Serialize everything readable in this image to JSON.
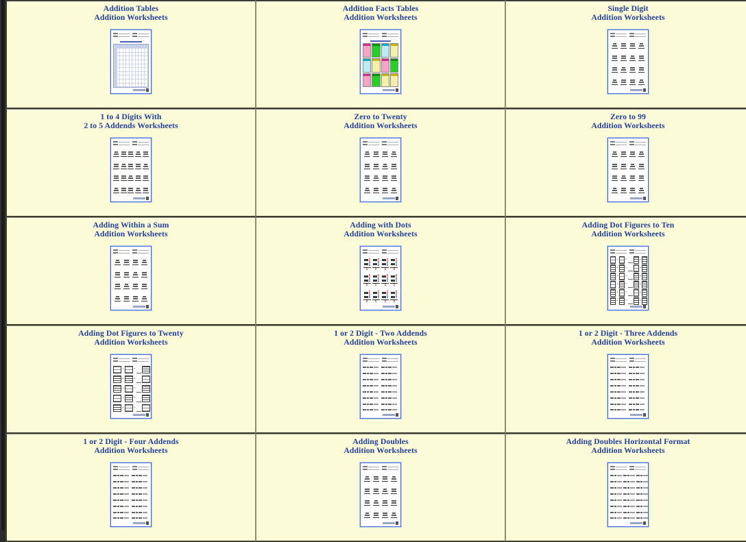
{
  "page": {
    "background_color": "#fbfbd8",
    "title_color": "#24409a",
    "border_color": "#3d3d30",
    "gutter_color": "#2b2b2b",
    "subtitle_common": "Addition Worksheets"
  },
  "grid": {
    "columns": 3,
    "rows": [
      {
        "cells": [
          {
            "title": "Addition Tables",
            "subtitle": "Addition Worksheets",
            "thumb_kind": "addition-table",
            "thumb_name": "addition-tables-thumbnail"
          },
          {
            "title": "Addition Facts Tables",
            "subtitle": "Addition Worksheets",
            "thumb_kind": "facts-tables",
            "thumb_name": "addition-facts-tables-thumbnail"
          },
          {
            "title": "Single Digit",
            "subtitle": "Addition Worksheets",
            "thumb_kind": "vertical-4x4",
            "thumb_name": "single-digit-thumbnail"
          }
        ]
      },
      {
        "cells": [
          {
            "title": "1 to 4 Digits With",
            "subtitle": "2 to 5 Addends Worksheets",
            "thumb_kind": "vertical-5x4-tall",
            "thumb_name": "1-to-4-digits-with-2-to-5-addends-thumbnail"
          },
          {
            "title": "Zero to Twenty",
            "subtitle": "Addition Worksheets",
            "thumb_kind": "vertical-4x4",
            "thumb_name": "zero-to-twenty-thumbnail"
          },
          {
            "title": "Zero to 99",
            "subtitle": "Addition Worksheets",
            "thumb_kind": "vertical-4x4",
            "thumb_name": "zero-to-99-thumbnail"
          }
        ]
      },
      {
        "cells": [
          {
            "title": "Adding Within a Sum",
            "subtitle": "Addition Worksheets",
            "thumb_kind": "vertical-4x4",
            "thumb_name": "adding-within-a-sum-thumbnail"
          },
          {
            "title": "Adding with Dots",
            "subtitle": "Addition Worksheets",
            "thumb_kind": "adding-with-dots",
            "thumb_name": "adding-with-dots-thumbnail"
          },
          {
            "title": "Adding Dot Figures to Ten",
            "subtitle": "Addition Worksheets",
            "thumb_kind": "dot-figures-ten",
            "thumb_name": "adding-dot-figures-to-ten-thumbnail"
          }
        ]
      },
      {
        "cells": [
          {
            "title": "Adding Dot Figures to Twenty",
            "subtitle": "Addition Worksheets",
            "thumb_kind": "dot-figures-twenty",
            "thumb_name": "adding-dot-figures-to-twenty-thumbnail"
          },
          {
            "title": "1 or 2 Digit - Two Addends",
            "subtitle": "Addition Worksheets",
            "thumb_kind": "horizontal-8x2",
            "thumb_name": "1-or-2-digit-two-addends-thumbnail"
          },
          {
            "title": "1 or 2 Digit - Three Addends",
            "subtitle": "Addition Worksheets",
            "thumb_kind": "horizontal-8x2",
            "thumb_name": "1-or-2-digit-three-addends-thumbnail"
          }
        ]
      },
      {
        "cells": [
          {
            "title": "1 or 2 Digit - Four Addends",
            "subtitle": "Addition Worksheets",
            "thumb_kind": "horizontal-8x2",
            "thumb_name": "1-or-2-digit-four-addends-thumbnail"
          },
          {
            "title": "Adding Doubles",
            "subtitle": "Addition Worksheets",
            "thumb_kind": "vertical-4x4",
            "thumb_name": "adding-doubles-thumbnail"
          },
          {
            "title": "Adding Doubles Horizontal Format",
            "subtitle": "Addition Worksheets",
            "thumb_kind": "horizontal-8x3",
            "thumb_name": "adding-doubles-horizontal-format-thumbnail"
          }
        ]
      }
    ]
  },
  "thumbnail_details": {
    "name_label": "Name:",
    "score_label": "Score:",
    "teacher_label": "Teacher:",
    "date_label": "Date:",
    "addition_table_caption": "Addition Table (1 - 10)",
    "facts_table_caption": "Addition Facts Table",
    "footer_credit": "Math-Aids.Com"
  }
}
